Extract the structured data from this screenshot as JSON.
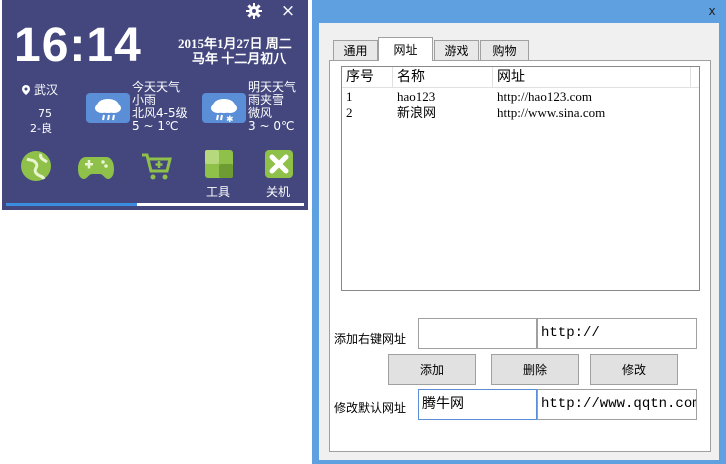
{
  "widget": {
    "close_glyph": "×",
    "time": "16:14",
    "date_line1": "2015年1月27日 周二",
    "date_line2": "马年 十二月初八",
    "location": "武汉",
    "aqi_value": "75",
    "aqi_label": "2-良",
    "today": {
      "title": "今天天气",
      "condition": "小雨",
      "wind": "北风4-5级",
      "temp": "5 ~ 1℃"
    },
    "tomorrow": {
      "title": "明天天气",
      "condition": "雨夹雪",
      "wind": "微风",
      "temp": "3 ~ 0℃"
    },
    "apps": {
      "tools_label": "工具",
      "power_label": "关机"
    },
    "progress_fraction": 0.44,
    "accent_color": "#43477e"
  },
  "dialog": {
    "close_glyph": "x",
    "tabs": [
      "通用",
      "网址",
      "游戏",
      "购物"
    ],
    "active_tab": "网址",
    "list": {
      "headers": [
        "序号",
        "名称",
        "网址"
      ],
      "rows": [
        {
          "no": "1",
          "name": "hao123",
          "url": "http://hao123.com"
        },
        {
          "no": "2",
          "name": "新浪网",
          "url": "http://www.sina.com"
        }
      ]
    },
    "add_label": "添加右键网址",
    "add_name_value": "",
    "add_url_value": "http://",
    "buttons": {
      "add": "添加",
      "delete": "删除",
      "edit": "修改"
    },
    "modify_label": "修改默认网址",
    "modify_name_value": "腾牛网",
    "modify_url_value": "http://www.qqtn.com/"
  }
}
